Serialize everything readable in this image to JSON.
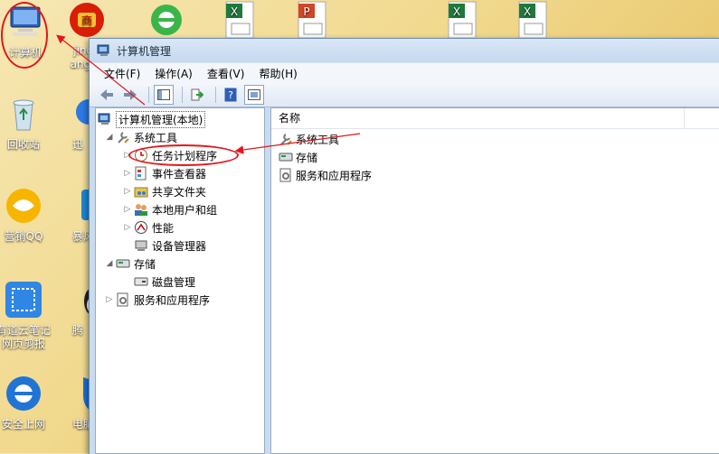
{
  "desktop": {
    "icons": [
      {
        "label": "计算机"
      },
      {
        "label": "jingd",
        "label2": "angjiu"
      },
      {
        "label": "回收站"
      },
      {
        "label": "迅"
      },
      {
        "label": "营销QQ"
      },
      {
        "label": "暴风"
      },
      {
        "label": "有道云笔记",
        "label2": "网页剪报"
      },
      {
        "label": "腾"
      },
      {
        "label": "安全上网"
      },
      {
        "label": "电脑"
      }
    ]
  },
  "window": {
    "title": "计算机管理",
    "menu": [
      "文件(F)",
      "操作(A)",
      "查看(V)",
      "帮助(H)"
    ],
    "toolbar_icons": [
      "back-icon",
      "forward-icon",
      "console-tree-icon",
      "export-icon",
      "help-icon",
      "view-icon"
    ]
  },
  "tree": {
    "root": "计算机管理(本地)",
    "system_tools": "系统工具",
    "task_scheduler": "任务计划程序",
    "event_viewer": "事件查看器",
    "shared_folders": "共享文件夹",
    "local_users": "本地用户和组",
    "performance": "性能",
    "device_manager": "设备管理器",
    "storage": "存储",
    "disk_management": "磁盘管理",
    "services_apps": "服务和应用程序"
  },
  "list": {
    "column_name": "名称",
    "items": [
      "系统工具",
      "存储",
      "服务和应用程序"
    ]
  },
  "colors": {
    "annotation_red": "#e4161b",
    "window_frame": "#c9dbef"
  }
}
